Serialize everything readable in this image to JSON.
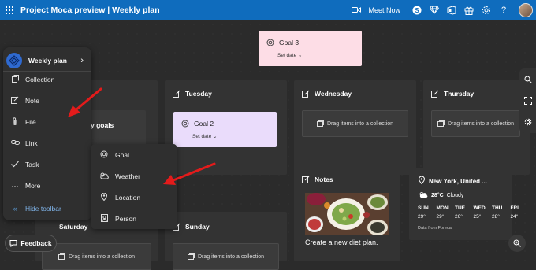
{
  "titlebar": {
    "title": "Project Moca preview | Weekly plan",
    "meet_now": "Meet Now",
    "icons": [
      "app-grid-icon",
      "video-icon",
      "skype-icon",
      "diamond-icon",
      "office-icon",
      "gift-icon",
      "settings-icon",
      "help-icon"
    ]
  },
  "toolbar": {
    "header": "Weekly plan",
    "items": [
      {
        "label": "Collection",
        "icon": "collection-icon"
      },
      {
        "label": "Note",
        "icon": "note-icon"
      },
      {
        "label": "File",
        "icon": "file-icon"
      },
      {
        "label": "Link",
        "icon": "link-icon"
      },
      {
        "label": "Task",
        "icon": "task-icon"
      },
      {
        "label": "More",
        "icon": "more-icon"
      }
    ],
    "hide": "Hide toolbar"
  },
  "submenu": {
    "items": [
      {
        "label": "Goal",
        "icon": "goal-icon"
      },
      {
        "label": "Weather",
        "icon": "weather-icon"
      },
      {
        "label": "Location",
        "icon": "location-icon"
      },
      {
        "label": "Person",
        "icon": "person-icon"
      }
    ]
  },
  "goal3": {
    "title": "Goal 3",
    "date": "Set date"
  },
  "goal2": {
    "title": "Goal 2",
    "date": "Set date"
  },
  "partial_goals": "y goals",
  "days": {
    "tuesday": "Tuesday",
    "wednesday": "Wednesday",
    "thursday": "Thursday",
    "saturday": "Saturday",
    "sunday": "Sunday"
  },
  "drag_text": "Drag items into a collection",
  "notes": {
    "title": "Notes",
    "caption": "Create a new diet plan."
  },
  "weather": {
    "location": "New York, United ...",
    "current_temp": "28°C",
    "condition": "Cloudy",
    "days": [
      "SUN",
      "MON",
      "TUE",
      "WED",
      "THU",
      "FRI"
    ],
    "temps": [
      "29°",
      "29°",
      "26°",
      "25°",
      "28°",
      "24°"
    ],
    "source": "Data from Foreca"
  },
  "feedback": "Feedback",
  "colors": {
    "titlebar": "#0f6cbd",
    "goal3_bg": "#fddde6",
    "goal2_bg": "#eadcfb",
    "arrow": "#e31b1b"
  }
}
